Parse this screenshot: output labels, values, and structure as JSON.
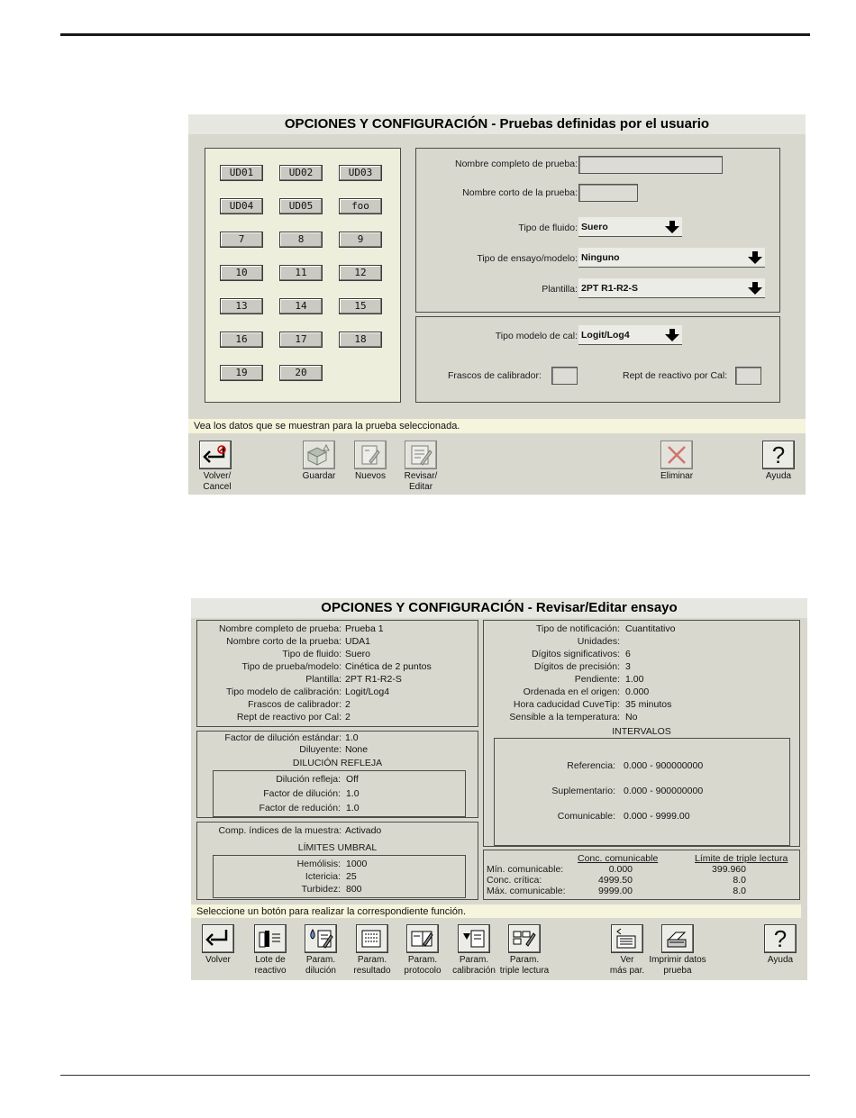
{
  "screen1": {
    "title": "OPCIONES Y CONFIGURACIÓN - Pruebas definidas por el usuario",
    "tests": [
      "UD01",
      "UD02",
      "UD03",
      "UD04",
      "UD05",
      "foo",
      "7",
      "8",
      "9",
      "10",
      "11",
      "12",
      "13",
      "14",
      "15",
      "16",
      "17",
      "18",
      "19",
      "20"
    ],
    "form": {
      "full_name_label": "Nombre completo de prueba:",
      "full_name_value": "",
      "short_name_label": "Nombre corto de la prueba:",
      "short_name_value": "",
      "fluid_type_label": "Tipo de fluido:",
      "fluid_type_value": "Suero",
      "assay_type_label": "Tipo de ensayo/modelo:",
      "assay_type_value": "Ninguno",
      "template_label": "Plantilla:",
      "template_value": "2PT R1-R2-S",
      "cal_model_label": "Tipo modelo de cal:",
      "cal_model_value": "Logit/Log4",
      "calibrator_vials_label": "Frascos de calibrador:",
      "calibrator_vials_value": "",
      "reagent_rep_label": "Rept de reactivo por Cal:",
      "reagent_rep_value": ""
    },
    "status": "Vea los datos que se muestran para la prueba seleccionada.",
    "toolbar": {
      "back": [
        "Volver/",
        "Cancel"
      ],
      "save": [
        "Guardar"
      ],
      "new": [
        "Nuevos"
      ],
      "review": [
        "Revisar/",
        "Editar"
      ],
      "delete": [
        "Eliminar"
      ],
      "help": [
        "Ayuda"
      ]
    }
  },
  "screen2": {
    "title": "OPCIONES Y CONFIGURACIÓN - Revisar/Editar ensayo",
    "general": [
      {
        "label": "Nombre completo de prueba:",
        "value": "Prueba 1"
      },
      {
        "label": "Nombre corto de la prueba:",
        "value": "UDA1"
      },
      {
        "label": "Tipo de fluido:",
        "value": "Suero"
      },
      {
        "label": "Tipo de prueba/modelo:",
        "value": "Cinética de 2 puntos"
      },
      {
        "label": "Plantilla:",
        "value": "2PT R1-R2-S"
      },
      {
        "label": "Tipo modelo de calibración:",
        "value": "Logit/Log4"
      },
      {
        "label": "Frascos de calibrador:",
        "value": "2"
      },
      {
        "label": "Rept de reactivo por Cal:",
        "value": "2"
      }
    ],
    "dilution": {
      "std_factor_label": "Factor de dilución estándar:",
      "std_factor_value": "1.0",
      "diluent_label": "Diluyente:",
      "diluent_value": "None",
      "reflex_title": "DILUCIÓN REFLEJA",
      "reflex": [
        {
          "label": "Dilución refleja:",
          "value": "Off"
        },
        {
          "label": "Factor de dilución:",
          "value": "1.0"
        },
        {
          "label": "Factor de redución:",
          "value": "1.0"
        }
      ]
    },
    "indices": {
      "label": "Comp. índices de la muestra:",
      "value": "Activado",
      "limits_title": "LÍMITES UMBRAL",
      "limits": [
        {
          "label": "Hemólisis:",
          "value": "1000"
        },
        {
          "label": "Ictericia:",
          "value": "25"
        },
        {
          "label": "Turbidez:",
          "value": "800"
        }
      ]
    },
    "results": [
      {
        "label": "Tipo de notificación:",
        "value": "Cuantitativo"
      },
      {
        "label": "Unidades:",
        "value": ""
      },
      {
        "label": "Dígitos significativos:",
        "value": "6"
      },
      {
        "label": "Dígitos de precisión:",
        "value": "3"
      },
      {
        "label": "Pendiente:",
        "value": "1.00"
      },
      {
        "label": "Ordenada en el origen:",
        "value": "0.000"
      },
      {
        "label": "Hora caducidad CuveTip:",
        "value": "35 minutos"
      },
      {
        "label": "Sensible a la temperatura:",
        "value": "No"
      }
    ],
    "intervals": {
      "title": "INTERVALOS",
      "rows": [
        {
          "label": "Referencia:",
          "value": "0.000 - 900000000"
        },
        {
          "label": "Suplementario:",
          "value": "0.000 - 900000000"
        },
        {
          "label": "Comunicable:",
          "value": "0.000 - 9999.00"
        }
      ]
    },
    "limits_table": {
      "col1": "Conc. comunicable",
      "col2": "Límite de triple lectura",
      "rows": [
        {
          "label": "Mín. comunicable:",
          "conc": "0.000",
          "triple": "399.960"
        },
        {
          "label": "Conc. crítica:",
          "conc": "4999.50",
          "triple": "8.0"
        },
        {
          "label": "Máx. comunicable:",
          "conc": "9999.00",
          "triple": "8.0"
        }
      ]
    },
    "status": "Seleccione un botón para realizar la correspondiente función.",
    "toolbar": {
      "back": [
        "Volver"
      ],
      "lot": [
        "Lote de",
        "reactivo"
      ],
      "dilution": [
        "Param.",
        "dilución"
      ],
      "result": [
        "Param.",
        "resultado"
      ],
      "protocol": [
        "Param.",
        "protocolo"
      ],
      "calibration": [
        "Param.",
        "calibración"
      ],
      "triple": [
        "Param.",
        "triple lectura"
      ],
      "more": [
        "Ver",
        "más par."
      ],
      "print": [
        "Imprimir datos",
        "prueba"
      ],
      "help": [
        "Ayuda"
      ]
    }
  }
}
